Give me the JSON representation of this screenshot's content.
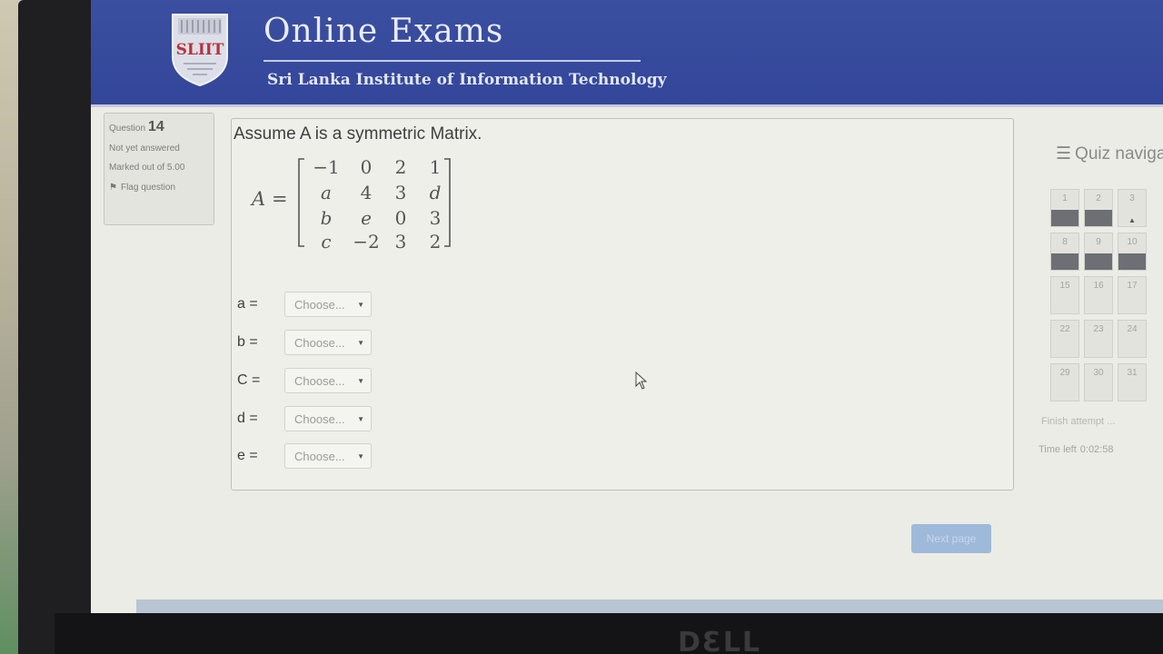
{
  "header": {
    "title": "Online Exams",
    "subtitle": "Sri Lanka Institute of Information Technology",
    "logo_text": "SLIIT"
  },
  "question_info": {
    "label": "Question",
    "number": "14",
    "status": "Not yet answered",
    "marks": "Marked out of 5.00",
    "flag_label": "Flag question"
  },
  "question": {
    "text": "Assume A is a symmetric Matrix.",
    "matrix_name": "A",
    "matrix_equals": "=",
    "matrix": [
      [
        "−1",
        "0",
        "2",
        "1"
      ],
      [
        "a",
        "4",
        "3",
        "d"
      ],
      [
        "b",
        "e",
        "0",
        "3"
      ],
      [
        "c",
        "−2",
        "3",
        "2"
      ]
    ],
    "answers": [
      {
        "label": "a =",
        "value": "Choose..."
      },
      {
        "label": "b =",
        "value": "Choose..."
      },
      {
        "label": "C =",
        "value": "Choose..."
      },
      {
        "label": "d =",
        "value": "Choose..."
      },
      {
        "label": "e =",
        "value": "Choose..."
      }
    ]
  },
  "quiz_nav": {
    "title": "Quiz naviga",
    "cells": [
      {
        "label": "1",
        "state": "answered"
      },
      {
        "label": "2",
        "state": "answered"
      },
      {
        "label": "3",
        "state": "current"
      },
      {
        "label": "8",
        "state": "answered"
      },
      {
        "label": "9",
        "state": "answered"
      },
      {
        "label": "10",
        "state": "answered"
      },
      {
        "label": "15",
        "state": "empty"
      },
      {
        "label": "16",
        "state": "empty"
      },
      {
        "label": "17",
        "state": "empty"
      },
      {
        "label": "22",
        "state": "empty"
      },
      {
        "label": "23",
        "state": "empty"
      },
      {
        "label": "24",
        "state": "empty"
      },
      {
        "label": "29",
        "state": "empty"
      },
      {
        "label": "30",
        "state": "empty"
      },
      {
        "label": "31",
        "state": "empty"
      }
    ],
    "finish_attempt": "Finish attempt ...",
    "time_left_label": "Time left",
    "time_left_value": "0:02:58"
  },
  "next_button": "Next page",
  "bezel_brand": "DƐLL",
  "colors": {
    "header_blue": "#3b4fa0",
    "page_bg": "#ecece6",
    "answered_bar": "#6d6f74",
    "button_blue": "#9fb9da"
  }
}
